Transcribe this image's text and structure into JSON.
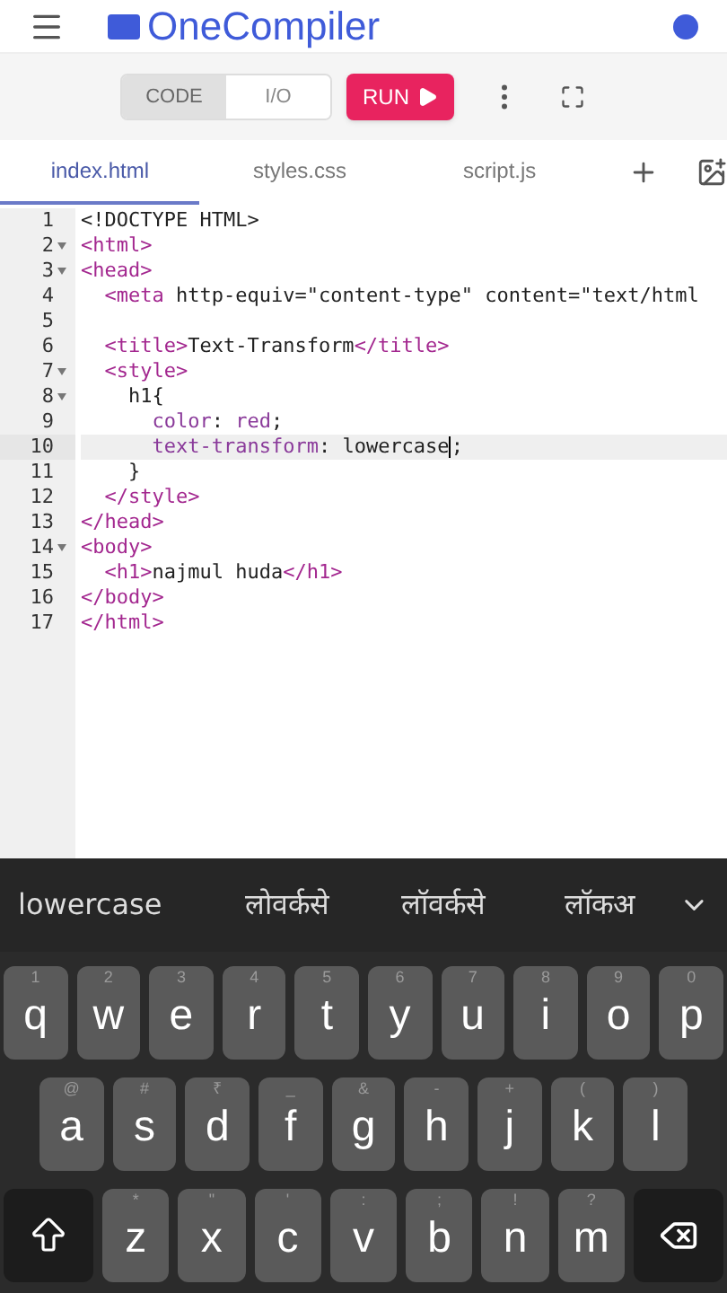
{
  "app": {
    "title": "OneCompiler"
  },
  "toolbar": {
    "modes": [
      {
        "label": "CODE",
        "selected": true
      },
      {
        "label": "I/O",
        "selected": false
      }
    ],
    "run": "RUN"
  },
  "tabs": [
    {
      "label": "index.html",
      "selected": true
    },
    {
      "label": "styles.css",
      "selected": false
    },
    {
      "label": "script.js",
      "selected": false
    }
  ],
  "editor": {
    "lines": [
      {
        "number": "1",
        "foldable": false,
        "active": false,
        "tokens": [
          {
            "kind": "plain",
            "text": "<!DOCTYPE HTML>"
          }
        ]
      },
      {
        "number": "2",
        "foldable": true,
        "active": false,
        "tokens": [
          {
            "kind": "tag",
            "text": "<html>"
          }
        ]
      },
      {
        "number": "3",
        "foldable": true,
        "active": false,
        "tokens": [
          {
            "kind": "tag",
            "text": "<head>"
          }
        ],
        "children": [
          {
            "number": "4",
            "foldable": false,
            "active": false,
            "tokens": [
              {
                "kind": "tag",
                "text": "<meta"
              },
              {
                "kind": "plain",
                "text": " http-equiv=\"content-type\" content=\"text/html"
              }
            ]
          },
          {
            "number": "5",
            "foldable": false,
            "active": false
          },
          {
            "number": "6",
            "foldable": false,
            "active": false,
            "tokens": [
              {
                "kind": "tag",
                "text": "<title>"
              },
              {
                "kind": "plain",
                "text": "Text-Transform"
              },
              {
                "kind": "tag",
                "text": "</title>"
              }
            ]
          },
          {
            "number": "7",
            "foldable": true,
            "active": false,
            "tokens": [
              {
                "kind": "tag",
                "text": "<style>"
              }
            ],
            "children": [
              {
                "number": "8",
                "foldable": true,
                "active": false,
                "tokens": [
                  {
                    "kind": "plain",
                    "text": "h1{"
                  }
                ],
                "children": [
                  {
                    "number": "9",
                    "foldable": false,
                    "active": false,
                    "tokens": [
                      {
                        "kind": "prop",
                        "text": "color"
                      },
                      {
                        "kind": "plain",
                        "text": ": "
                      },
                      {
                        "kind": "prop",
                        "text": "red"
                      },
                      {
                        "kind": "plain",
                        "text": ";"
                      }
                    ]
                  },
                  {
                    "number": "10",
                    "foldable": false,
                    "active": true,
                    "tokens": [
                      {
                        "kind": "prop",
                        "text": "text-transform"
                      },
                      {
                        "kind": "plain",
                        "text": ": lowercase"
                      },
                      {
                        "kind": "cursor"
                      },
                      {
                        "kind": "plain",
                        "text": ";"
                      }
                    ]
                  }
                ]
              },
              {
                "number": "11",
                "foldable": false,
                "active": false,
                "tokens": [
                  {
                    "kind": "plain",
                    "text": "}"
                  }
                ]
              }
            ]
          },
          {
            "number": "12",
            "foldable": false,
            "active": false,
            "tokens": [
              {
                "kind": "tag",
                "text": "</style>"
              }
            ]
          }
        ]
      },
      {
        "number": "13",
        "foldable": false,
        "active": false,
        "tokens": [
          {
            "kind": "tag",
            "text": "</head>"
          }
        ]
      },
      {
        "number": "14",
        "foldable": true,
        "active": false,
        "tokens": [
          {
            "kind": "tag",
            "text": "<body>"
          }
        ],
        "children": [
          {
            "number": "15",
            "foldable": false,
            "active": false,
            "tokens": [
              {
                "kind": "tag",
                "text": "<h1>"
              },
              {
                "kind": "plain",
                "text": "najmul huda"
              },
              {
                "kind": "tag",
                "text": "</h1>"
              }
            ]
          }
        ]
      },
      {
        "number": "16",
        "foldable": false,
        "active": false,
        "tokens": [
          {
            "kind": "tag",
            "text": "</body>"
          }
        ]
      },
      {
        "number": "17",
        "foldable": false,
        "active": false,
        "tokens": [
          {
            "kind": "tag",
            "text": "</html>"
          }
        ]
      }
    ]
  },
  "keyboard": {
    "suggestions": [
      "lowercase",
      "लोवर्कसे",
      "लॉवर्कसे",
      "लॉकअ"
    ],
    "rows": [
      [
        {
          "kind": "letter",
          "label": "q",
          "hint": "1"
        },
        {
          "kind": "letter",
          "label": "w",
          "hint": "2"
        },
        {
          "kind": "letter",
          "label": "e",
          "hint": "3"
        },
        {
          "kind": "letter",
          "label": "r",
          "hint": "4"
        },
        {
          "kind": "letter",
          "label": "t",
          "hint": "5"
        },
        {
          "kind": "letter",
          "label": "y",
          "hint": "6"
        },
        {
          "kind": "letter",
          "label": "u",
          "hint": "7"
        },
        {
          "kind": "letter",
          "label": "i",
          "hint": "8"
        },
        {
          "kind": "letter",
          "label": "o",
          "hint": "9"
        },
        {
          "kind": "letter",
          "label": "p",
          "hint": "0"
        }
      ],
      [
        {
          "kind": "letter",
          "label": "a",
          "hint": "@"
        },
        {
          "kind": "letter",
          "label": "s",
          "hint": "#"
        },
        {
          "kind": "letter",
          "label": "d",
          "hint": "₹"
        },
        {
          "kind": "letter",
          "label": "f",
          "hint": "_"
        },
        {
          "kind": "letter",
          "label": "g",
          "hint": "&"
        },
        {
          "kind": "letter",
          "label": "h",
          "hint": "-"
        },
        {
          "kind": "letter",
          "label": "j",
          "hint": "+"
        },
        {
          "kind": "letter",
          "label": "k",
          "hint": "("
        },
        {
          "kind": "letter",
          "label": "l",
          "hint": ")"
        }
      ],
      [
        {
          "kind": "shift"
        },
        {
          "kind": "letter",
          "label": "z",
          "hint": "*"
        },
        {
          "kind": "letter",
          "label": "x",
          "hint": "\""
        },
        {
          "kind": "letter",
          "label": "c",
          "hint": "'"
        },
        {
          "kind": "letter",
          "label": "v",
          "hint": ":"
        },
        {
          "kind": "letter",
          "label": "b",
          "hint": ";"
        },
        {
          "kind": "letter",
          "label": "n",
          "hint": "!"
        },
        {
          "kind": "letter",
          "label": "m",
          "hint": "?"
        },
        {
          "kind": "backspace"
        }
      ]
    ]
  }
}
